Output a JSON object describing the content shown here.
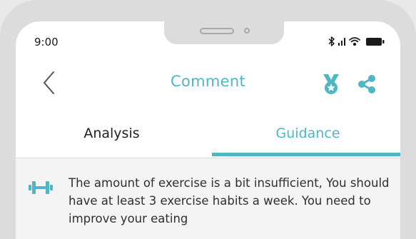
{
  "status_bar": {
    "time": "9:00"
  },
  "nav": {
    "title": "Comment"
  },
  "tabs": [
    {
      "label": "Analysis",
      "active": false
    },
    {
      "label": "Guidance",
      "active": true
    }
  ],
  "guidance": {
    "text": "The amount of exercise is a bit insufficient, You should have at least 3 exercise habits a week. You need to improve your eating"
  },
  "colors": {
    "accent": "#4fb6c4",
    "frame": "#dcdcdc",
    "card_bg": "#f4f4f4",
    "text_dark": "#222222"
  },
  "icons": [
    "bluetooth-icon",
    "signal-icon",
    "wifi-icon",
    "battery-icon",
    "back-arrow-icon",
    "medal-icon",
    "share-icon",
    "dumbbell-icon"
  ]
}
